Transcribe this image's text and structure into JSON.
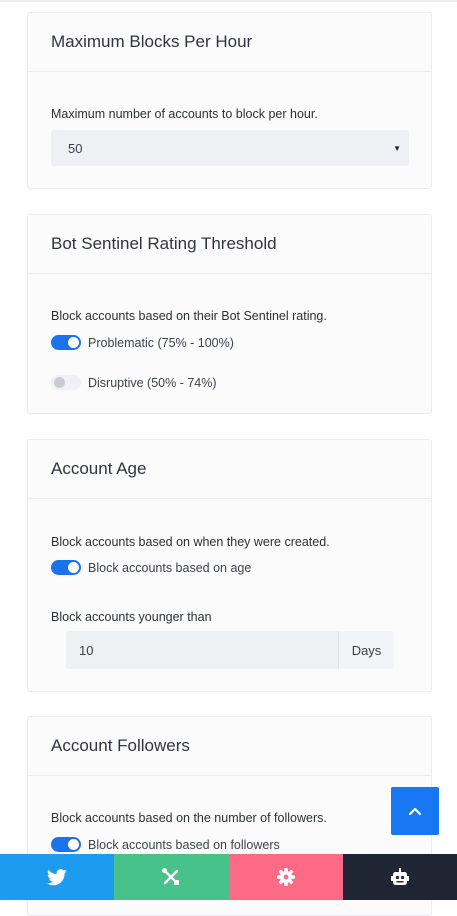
{
  "cards": {
    "max_blocks": {
      "title": "Maximum Blocks Per Hour",
      "description": "Maximum number of accounts to block per hour.",
      "select_value": "50"
    },
    "rating_threshold": {
      "title": "Bot Sentinel Rating Threshold",
      "description": "Block accounts based on their Bot Sentinel rating.",
      "options": [
        {
          "label": "Problematic (75% - 100%)",
          "enabled": true
        },
        {
          "label": "Disruptive (50% - 74%)",
          "enabled": false
        }
      ]
    },
    "account_age": {
      "title": "Account Age",
      "description": "Block accounts based on when they were created.",
      "toggle_label": "Block accounts based on age",
      "toggle_enabled": true,
      "younger_label": "Block accounts younger than",
      "younger_value": "10",
      "younger_unit": "Days"
    },
    "followers": {
      "title": "Account Followers",
      "description": "Block accounts based on the number of followers.",
      "toggle_label": "Block accounts based on followers",
      "toggle_enabled": true
    }
  },
  "bottom_nav": [
    {
      "icon": "twitter-icon",
      "color": "#1d9bf0"
    },
    {
      "icon": "tools-icon",
      "color": "#47c28a"
    },
    {
      "icon": "gear-icon",
      "color": "#fd6a86"
    },
    {
      "icon": "robot-icon",
      "color": "#1f2532"
    }
  ],
  "colors": {
    "accent": "#1877f2"
  }
}
